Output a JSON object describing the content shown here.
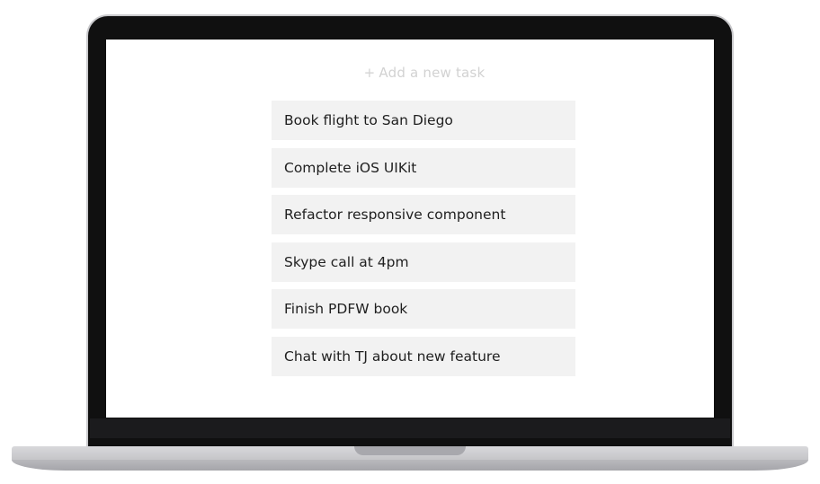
{
  "add_task": {
    "plus": "+",
    "label": "Add a new task"
  },
  "tasks": [
    {
      "label": "Book flight to San Diego"
    },
    {
      "label": "Complete iOS UIKit"
    },
    {
      "label": "Refactor responsive component"
    },
    {
      "label": "Skype call at 4pm"
    },
    {
      "label": "Finish PDFW book"
    },
    {
      "label": "Chat with TJ about new feature"
    }
  ],
  "colors": {
    "bezel": "#101010",
    "task_background": "#f2f2f2",
    "placeholder_text": "#d2d2d2",
    "task_text": "#1f1f1f"
  }
}
